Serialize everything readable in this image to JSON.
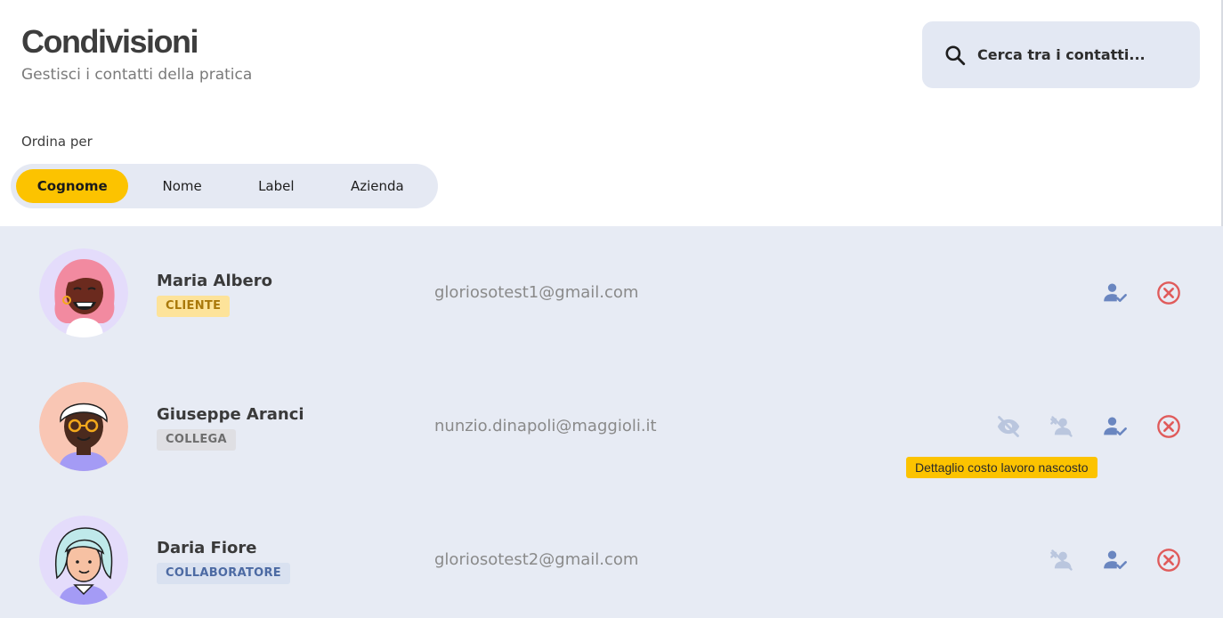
{
  "header": {
    "title": "Condivisioni",
    "subtitle": "Gestisci i contatti della pratica"
  },
  "search": {
    "placeholder": "Cerca tra i contatti...",
    "icon": "search-icon"
  },
  "sort": {
    "label": "Ordina per",
    "options": [
      "Cognome",
      "Nome",
      "Label",
      "Azienda"
    ],
    "selected": "Cognome"
  },
  "contacts": [
    {
      "name": "Maria Albero",
      "label": "CLIENTE",
      "email": "gloriosotest1@gmail.com",
      "actions": [
        "person-check-icon",
        "remove-circle-icon"
      ]
    },
    {
      "name": "Giuseppe Aranci",
      "label": "COLLEGA",
      "email": "nunzio.dinapoli@maggioli.it",
      "actions": [
        "eye-off-icon",
        "person-off-icon",
        "person-check-icon",
        "remove-circle-icon"
      ]
    },
    {
      "name": "Daria Fiore",
      "label": "COLLABORATORE",
      "email": "gloriosotest2@gmail.com",
      "actions": [
        "person-off-icon",
        "person-check-icon",
        "remove-circle-icon"
      ]
    }
  ],
  "tooltip": {
    "text": "Dettaglio costo lavoro nascosto"
  },
  "colors": {
    "accent": "#fcc300",
    "panel": "#e7ebf4",
    "icon_blue": "#6a86c0",
    "icon_faded": "#bac6de",
    "remove_red": "#e05b5b"
  }
}
